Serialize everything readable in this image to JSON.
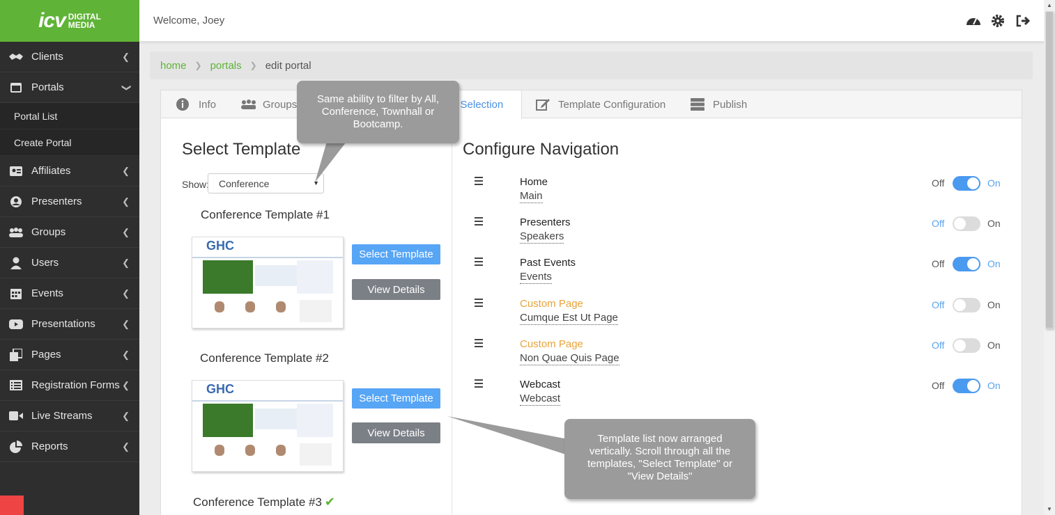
{
  "brand": {
    "logo_main": "icv",
    "logo_line1": "DIGITAL",
    "logo_line2": "MEDIA",
    "green": "#5fb336"
  },
  "header": {
    "welcome": "Welcome, Joey",
    "icons": [
      "dashboard-icon",
      "gear-icon",
      "sign-out-icon"
    ]
  },
  "sidebar": {
    "items": [
      {
        "label": "Clients",
        "icon": "handshake-icon"
      },
      {
        "label": "Portals",
        "icon": "window-icon",
        "expanded": true
      },
      {
        "label": "Affiliates",
        "icon": "id-card-icon"
      },
      {
        "label": "Presenters",
        "icon": "user-circle-icon"
      },
      {
        "label": "Groups",
        "icon": "users-icon"
      },
      {
        "label": "Users",
        "icon": "user-icon"
      },
      {
        "label": "Events",
        "icon": "calendar-icon"
      },
      {
        "label": "Presentations",
        "icon": "play-icon"
      },
      {
        "label": "Pages",
        "icon": "copy-icon"
      },
      {
        "label": "Registration Forms",
        "icon": "list-icon"
      },
      {
        "label": "Live Streams",
        "icon": "video-icon"
      },
      {
        "label": "Reports",
        "icon": "pie-chart-icon"
      }
    ],
    "sub_items": [
      "Portal List",
      "Create Portal"
    ]
  },
  "breadcrumb": {
    "home": "home",
    "portals": "portals",
    "current": "edit portal"
  },
  "tabs": [
    {
      "label": "Info"
    },
    {
      "label": "Groups"
    },
    {
      "label": "e Selection"
    },
    {
      "label": "Template Configuration"
    },
    {
      "label": "Publish"
    }
  ],
  "left": {
    "heading": "Select Template",
    "show_label": "Show:",
    "show_value": "Conference",
    "templates": [
      {
        "title": "Conference Template #1",
        "select": "Select Template",
        "details": "View Details"
      },
      {
        "title": "Conference Template #2",
        "select": "Select Template",
        "details": "View Details"
      },
      {
        "title": "Conference Template #3"
      }
    ],
    "thumb_logo": "GHC"
  },
  "right": {
    "heading": "Configure Navigation",
    "off_label": "Off",
    "on_label": "On",
    "rows": [
      {
        "title": "Home",
        "sub": "Main",
        "on": true,
        "custom": false
      },
      {
        "title": "Presenters",
        "sub": "Speakers",
        "on": false,
        "custom": false
      },
      {
        "title": "Past Events",
        "sub": "Events",
        "on": true,
        "custom": false
      },
      {
        "title": "Custom Page",
        "sub": "Cumque Est Ut Page",
        "on": false,
        "custom": true
      },
      {
        "title": "Custom Page",
        "sub": "Non Quae Quis Page",
        "on": false,
        "custom": true
      },
      {
        "title": "Webcast",
        "sub": "Webcast",
        "on": true,
        "custom": false
      }
    ]
  },
  "callouts": {
    "filter": "Same ability to filter by All, Conference, Townhall or Bootcamp.",
    "list": "Template list now arranged vertically. Scroll through all the templates, \"Select Template\" or \"View Details\""
  }
}
